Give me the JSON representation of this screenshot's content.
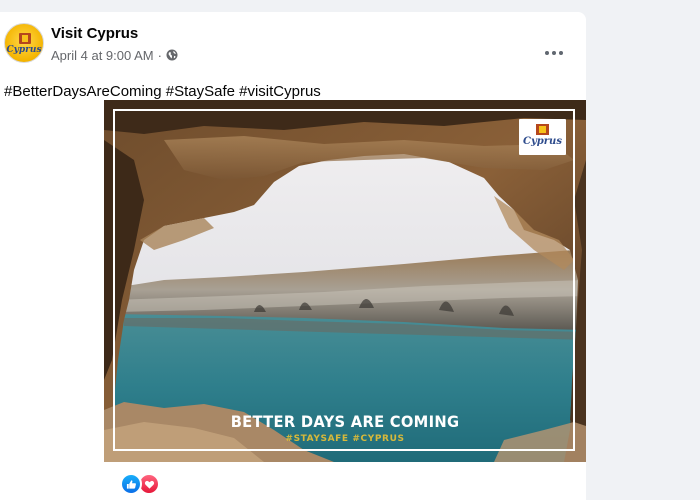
{
  "post": {
    "author": "Visit Cyprus",
    "timestamp": "April 4 at 9:00 AM",
    "separator": "·",
    "audience_icon": "globe-icon",
    "more_icon": "more-options-icon",
    "caption": "#BetterDaysAreComing #StaySafe #visitCyprus"
  },
  "avatar": {
    "wordmark": "Cyprus"
  },
  "image": {
    "logo_wordmark": "Cyprus",
    "headline": "BETTER DAYS ARE COMING",
    "tagline": "#STAYSAFE #CYPRUS"
  },
  "reactions": [
    {
      "name": "like-reaction-icon"
    },
    {
      "name": "love-reaction-icon"
    }
  ],
  "colors": {
    "page_bg": "#f0f2f5",
    "card_bg": "#ffffff",
    "text_primary": "#050505",
    "text_secondary": "#65676b",
    "like_blue": "#1877f2",
    "love_red": "#f33e58",
    "tagline_gold": "#d8b93a"
  }
}
